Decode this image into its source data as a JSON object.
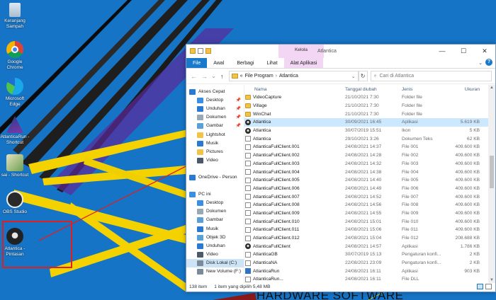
{
  "desktop": {
    "icons": [
      {
        "label": "Keranjang Sampah",
        "icon": "recycle-bin-icon"
      },
      {
        "label": "Google Chrome",
        "icon": "chrome-icon"
      },
      {
        "label": "Microsoft Edge",
        "icon": "edge-icon"
      },
      {
        "label": "AtlanticaRun - Shortcut",
        "icon": "atlantica-run-icon"
      },
      {
        "label": "sai - Shortcut",
        "icon": "sai-icon"
      },
      {
        "label": "OBS Studio",
        "icon": "obs-icon"
      },
      {
        "label": "Atlantica - Pintasan",
        "icon": "atlantica-icon"
      }
    ],
    "watermark": "HARDWARE SOFTWARE",
    "highlight_color": "#e0201e"
  },
  "window": {
    "title": "Atlantica",
    "kelola_label": "Kelola",
    "controls": {
      "minimize": "—",
      "maximize": "☐",
      "close": "✕"
    },
    "ribbon_tabs": [
      "File",
      "Awal",
      "Berbagi",
      "Lihat",
      "Alat Aplikasi"
    ],
    "address": {
      "prefix": "«",
      "parts": [
        "File Program",
        "Atlantica"
      ]
    },
    "search_placeholder": "Cari di Atlantica",
    "nav_glyphs": {
      "back": "←",
      "forward": "→",
      "recent": "⌄",
      "up": "↑",
      "refresh": "↻",
      "expand": "⌄"
    }
  },
  "nav_pane": {
    "items": [
      {
        "label": "Akses Cepat",
        "icon": "star-icon",
        "color": "#2a7ad4",
        "indent": 0,
        "pin": false
      },
      {
        "label": "Desktop",
        "icon": "desktop-icon",
        "color": "#3a8ee6",
        "indent": 1,
        "pin": true
      },
      {
        "label": "Unduhan",
        "icon": "download-icon",
        "color": "#2a7ad4",
        "indent": 1,
        "pin": true
      },
      {
        "label": "Dokumen",
        "icon": "documents-icon",
        "color": "#9aa7b4",
        "indent": 1,
        "pin": true
      },
      {
        "label": "Gambar",
        "icon": "pictures-icon",
        "color": "#5aa0d8",
        "indent": 1,
        "pin": true
      },
      {
        "label": "Lightshot",
        "icon": "folder-icon",
        "color": "#f1c447",
        "indent": 1,
        "pin": false
      },
      {
        "label": "Musik",
        "icon": "music-icon",
        "color": "#2a7ad4",
        "indent": 1,
        "pin": false
      },
      {
        "label": "Pictures",
        "icon": "folder-icon",
        "color": "#f1c447",
        "indent": 1,
        "pin": false
      },
      {
        "label": "Video",
        "icon": "video-icon",
        "color": "#4a5a6a",
        "indent": 1,
        "pin": false
      },
      {
        "label": "",
        "icon": "",
        "color": "",
        "indent": 0,
        "pin": false
      },
      {
        "label": "OneDrive - Person",
        "icon": "cloud-icon",
        "color": "#2a7ad4",
        "indent": 0,
        "pin": false
      },
      {
        "label": "",
        "icon": "",
        "color": "",
        "indent": 0,
        "pin": false
      },
      {
        "label": "PC ini",
        "icon": "pc-icon",
        "color": "#3a8ee6",
        "indent": 0,
        "pin": false
      },
      {
        "label": "Desktop",
        "icon": "desktop-icon",
        "color": "#3a8ee6",
        "indent": 1,
        "pin": false
      },
      {
        "label": "Dokumen",
        "icon": "documents-icon",
        "color": "#9aa7b4",
        "indent": 1,
        "pin": false
      },
      {
        "label": "Gambar",
        "icon": "pictures-icon",
        "color": "#5aa0d8",
        "indent": 1,
        "pin": false
      },
      {
        "label": "Musik",
        "icon": "music-icon",
        "color": "#2a7ad4",
        "indent": 1,
        "pin": false
      },
      {
        "label": "Objek 3D",
        "icon": "objects-3d-icon",
        "color": "#5aa0d8",
        "indent": 1,
        "pin": false
      },
      {
        "label": "Unduhan",
        "icon": "download-icon",
        "color": "#2a7ad4",
        "indent": 1,
        "pin": false
      },
      {
        "label": "Video",
        "icon": "video-icon",
        "color": "#4a5a6a",
        "indent": 1,
        "pin": false
      },
      {
        "label": "Disk Lokal (C:)",
        "icon": "drive-icon",
        "color": "#7a8a99",
        "indent": 1,
        "pin": false,
        "selected": true
      },
      {
        "label": "New Volume (F:)",
        "icon": "drive-icon",
        "color": "#7a8a99",
        "indent": 1,
        "pin": false
      }
    ]
  },
  "columns": {
    "name": "Nama",
    "date": "Tanggal diubah",
    "type": "Jenis",
    "size": "Ukuran"
  },
  "files": [
    {
      "name": "VideoCapture",
      "date": "21/10/2021 7:30",
      "type": "Folder file",
      "size": "",
      "icon": "folder"
    },
    {
      "name": "Village",
      "date": "21/10/2021 7:30",
      "type": "Folder file",
      "size": "",
      "icon": "folder"
    },
    {
      "name": "WinChat",
      "date": "21/10/2021 7:30",
      "type": "Folder file",
      "size": "",
      "icon": "folder"
    },
    {
      "name": "Atlantica",
      "date": "30/09/2021 16:45",
      "type": "Aplikasi",
      "size": "5.619 KB",
      "icon": "app",
      "selected": true
    },
    {
      "name": "Atlantica",
      "date": "30/07/2019 15:51",
      "type": "Ikon",
      "size": "5 KB",
      "icon": "app"
    },
    {
      "name": "Atlantica",
      "date": "29/10/2021 3:26",
      "type": "Dokumen Teks",
      "size": "62 KB",
      "icon": "file"
    },
    {
      "name": "AtlanticaFullClient.001",
      "date": "24/08/2021 14:37",
      "type": "File 001",
      "size": "409.600 KB",
      "icon": "file"
    },
    {
      "name": "AtlanticaFullClient.002",
      "date": "24/08/2021 14:28",
      "type": "File 002",
      "size": "409.600 KB",
      "icon": "file"
    },
    {
      "name": "AtlanticaFullClient.003",
      "date": "24/08/2021 14:32",
      "type": "File 003",
      "size": "409.600 KB",
      "icon": "file"
    },
    {
      "name": "AtlanticaFullClient.004",
      "date": "24/08/2021 14:38",
      "type": "File 004",
      "size": "409.600 KB",
      "icon": "file"
    },
    {
      "name": "AtlanticaFullClient.005",
      "date": "24/08/2021 14:40",
      "type": "File 005",
      "size": "409.600 KB",
      "icon": "file"
    },
    {
      "name": "AtlanticaFullClient.006",
      "date": "24/08/2021 14:49",
      "type": "File 006",
      "size": "409.600 KB",
      "icon": "file"
    },
    {
      "name": "AtlanticaFullClient.007",
      "date": "24/08/2021 14:52",
      "type": "File 007",
      "size": "409.600 KB",
      "icon": "file"
    },
    {
      "name": "AtlanticaFullClient.008",
      "date": "24/08/2021 14:56",
      "type": "File 008",
      "size": "409.600 KB",
      "icon": "file"
    },
    {
      "name": "AtlanticaFullClient.009",
      "date": "24/08/2021 14:55",
      "type": "File 009",
      "size": "409.600 KB",
      "icon": "file"
    },
    {
      "name": "AtlanticaFullClient.010",
      "date": "24/08/2021 15:01",
      "type": "File 010",
      "size": "409.600 KB",
      "icon": "file"
    },
    {
      "name": "AtlanticaFullClient.011",
      "date": "24/08/2021 15:06",
      "type": "File 011",
      "size": "409.600 KB",
      "icon": "file"
    },
    {
      "name": "AtlanticaFullClient.012",
      "date": "24/08/2021 15:04",
      "type": "File 012",
      "size": "208.688 KB",
      "icon": "file"
    },
    {
      "name": "AtlanticaFullClient",
      "date": "24/08/2021 14:57",
      "type": "Aplikasi",
      "size": "1.786 KB",
      "icon": "app"
    },
    {
      "name": "AtlanticaGB",
      "date": "30/07/2019 15:13",
      "type": "Pengaturan konfi...",
      "size": "2 KB",
      "icon": "file"
    },
    {
      "name": "AtlanticaNA",
      "date": "22/08/2021 23:09",
      "type": "Pengaturan konfi...",
      "size": "2 KB",
      "icon": "file"
    },
    {
      "name": "AtlanticaRun",
      "date": "24/08/2021 16:11",
      "type": "Aplikasi",
      "size": "903 KB",
      "icon": "run"
    },
    {
      "name": "AtlanticaRun...",
      "date": "24/08/2021 16:11",
      "type": "File DLL",
      "size": "",
      "icon": "file"
    }
  ],
  "statusbar": {
    "count": "138 item",
    "selection": "1 item yang dipilih  5,48 MB"
  }
}
